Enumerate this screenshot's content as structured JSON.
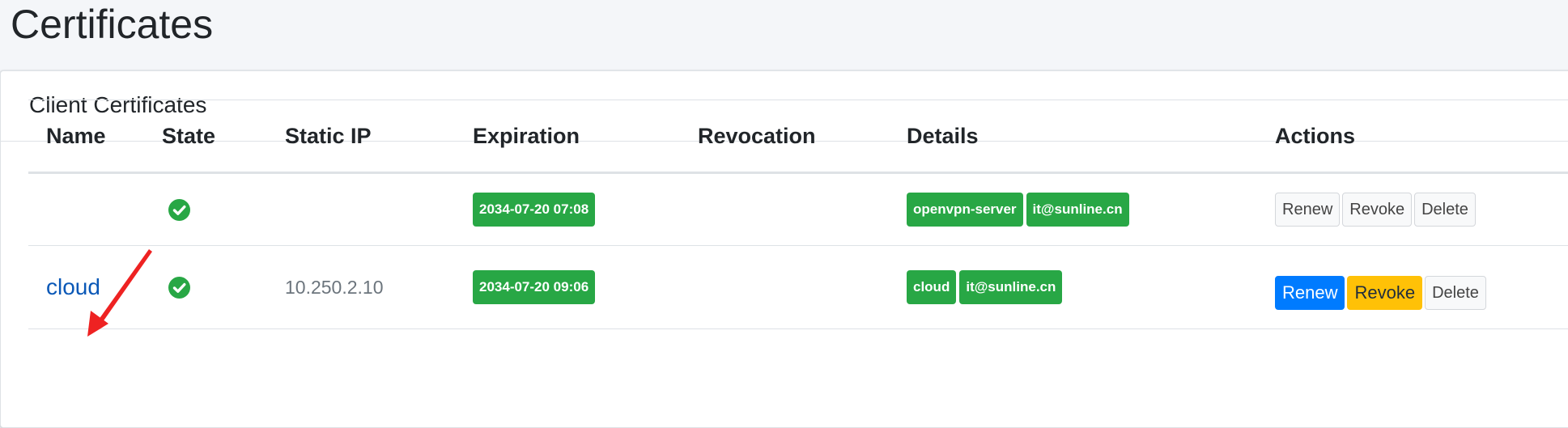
{
  "page": {
    "title": "Certificates"
  },
  "card": {
    "title": "Client Certificates"
  },
  "table": {
    "headers": {
      "name": "Name",
      "state": "State",
      "static_ip": "Static IP",
      "expiration": "Expiration",
      "revocation": "Revocation",
      "details": "Details",
      "actions": "Actions"
    },
    "rows": [
      {
        "name": "",
        "state": "valid",
        "static_ip": "",
        "expiration": "2034-07-20 07:08",
        "revocation": "",
        "details": [
          "openvpn-server",
          "it@sunline.cn"
        ],
        "actions": {
          "renew": "Renew",
          "revoke": "Revoke",
          "delete": "Delete"
        }
      },
      {
        "name": "cloud",
        "state": "valid",
        "static_ip": "10.250.2.10",
        "expiration": "2034-07-20 09:06",
        "revocation": "",
        "details": [
          "cloud",
          "it@sunline.cn"
        ],
        "actions": {
          "renew": "Renew",
          "revoke": "Revoke",
          "delete": "Delete"
        }
      }
    ]
  },
  "colors": {
    "success": "#28a745",
    "primary": "#007bff",
    "warning": "#ffc107",
    "annotation_arrow": "#ee2222"
  },
  "icons": {
    "state": "check-circle-icon",
    "annotation": "red-arrow-annotation"
  }
}
